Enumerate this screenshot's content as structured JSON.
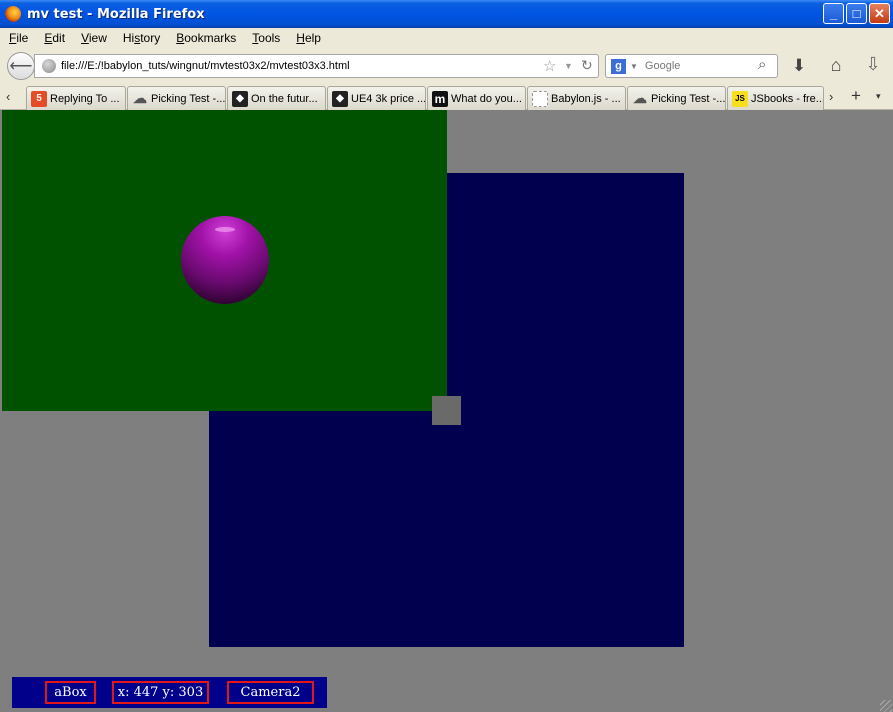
{
  "window": {
    "title": "mv test - Mozilla Firefox",
    "icon": "firefox-icon",
    "controls": {
      "minimize": "_",
      "maximize": "□",
      "close": "✕"
    }
  },
  "menubar": {
    "items": [
      {
        "accel": "F",
        "rest": "ile"
      },
      {
        "accel": "E",
        "rest": "dit"
      },
      {
        "accel": "V",
        "rest": "iew"
      },
      {
        "accel": "",
        "pre": "Hi",
        "accel2": "s",
        "rest": "tory"
      },
      {
        "accel": "B",
        "rest": "ookmarks"
      },
      {
        "accel": "T",
        "rest": "ools"
      },
      {
        "accel": "H",
        "rest": "elp"
      }
    ]
  },
  "navbar": {
    "url": "file:///E:/!babylon_tuts/wingnut/mvtest03x2/mvtest03x3.html",
    "search_placeholder": "Google",
    "search_engine_glyph": "g",
    "icons": {
      "back": "back-arrow-icon",
      "globe": "globe-icon",
      "star": "bookmark-star-icon",
      "reload": "reload-icon",
      "search": "magnifier-icon",
      "downloads": "download-arrow-icon",
      "home": "home-icon",
      "download_panel": "download-panel-icon"
    }
  },
  "tabs": [
    {
      "label": "Replying To ...",
      "icon": "html5-icon",
      "glyph": "5"
    },
    {
      "label": "Picking Test -...",
      "icon": "cloud-icon",
      "glyph": "☁"
    },
    {
      "label": "On the futur...",
      "icon": "unity-icon",
      "glyph": "◆"
    },
    {
      "label": "UE4 3k price ...",
      "icon": "unity-icon",
      "glyph": "◆"
    },
    {
      "label": "What do you...",
      "icon": "m-icon",
      "glyph": "m"
    },
    {
      "label": "Babylon.js - ...",
      "icon": "blank-page-icon",
      "glyph": ""
    },
    {
      "label": "Picking Test -...",
      "icon": "cloud-icon",
      "glyph": "☁"
    },
    {
      "label": "JSbooks - fre...",
      "icon": "js-icon",
      "glyph": "JS"
    }
  ],
  "tabstrip": {
    "scroll_left": "‹",
    "scroll_right": "›",
    "new_tab": "+",
    "all_tabs": "▾"
  },
  "scene": {
    "colors": {
      "background": "#7f7f7f",
      "viewport_blue": "#00004f",
      "viewport_green": "#005200",
      "sphere": "#a112a8",
      "drag_handle": "#6a6a6a",
      "hud_background": "#00008a",
      "hud_border": "#e01818"
    },
    "hud": {
      "mesh_name": "aBox",
      "coords": "x: 447 y: 303",
      "camera": "Camera2"
    }
  }
}
